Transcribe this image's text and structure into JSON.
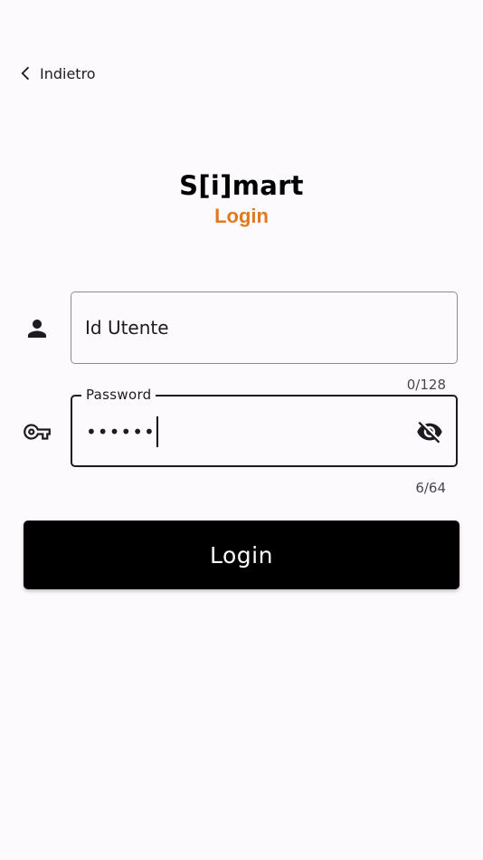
{
  "header": {
    "back_icon": "chevron-left-icon",
    "back_label": "Indietro"
  },
  "brand": {
    "title": "S[i]mart",
    "subtitle": "Login",
    "accent_color": "#e07a1c"
  },
  "form": {
    "user_field": {
      "icon": "person-icon",
      "placeholder": "Id Utente",
      "value": "",
      "counter": "0/128"
    },
    "password_field": {
      "icon": "key-icon",
      "label": "Password",
      "masked_value": "••••••",
      "counter": "6/64",
      "visibility_icon": "eye-off-icon"
    },
    "submit_label": "Login",
    "submit_color": "#000000"
  }
}
